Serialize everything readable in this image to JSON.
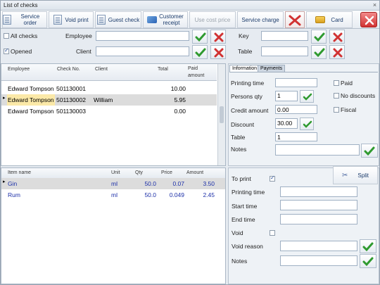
{
  "window": {
    "title": "List of checks",
    "close": "×"
  },
  "toolbar": {
    "service_order": "Service order",
    "void_print": "Void print",
    "guest_check": "Guest check",
    "customer_receipt": "Customer receipt",
    "use_cost_price": "Use cost price",
    "service_charge": "Service charge",
    "card": "Card"
  },
  "filters": {
    "all_checks": "All checks",
    "opened": "Opened",
    "employee_label": "Employee",
    "client_label": "Client",
    "key_label": "Key",
    "table_label": "Table",
    "employee_value": "",
    "client_value": "",
    "key_value": "",
    "table_value": ""
  },
  "checks_grid": {
    "headers": {
      "employee": "Employee",
      "check_no": "Check No.",
      "client": "Client",
      "total": "Total",
      "paid": "Paid amount"
    },
    "rows": [
      {
        "employee": "Edward Tompson",
        "check_no": "501130001",
        "client": "",
        "total": "10.00",
        "paid": ""
      },
      {
        "employee": "Edward Tompson",
        "check_no": "501130002",
        "client": "William",
        "total": "5.95",
        "paid": ""
      },
      {
        "employee": "Edward Tompson",
        "check_no": "501130003",
        "client": "",
        "total": "0.00",
        "paid": ""
      }
    ]
  },
  "items_grid": {
    "headers": {
      "name": "Item name",
      "unit": "Unit",
      "qty": "Qty",
      "price": "Price",
      "amount": "Amount"
    },
    "rows": [
      {
        "name": "Gin",
        "unit": "ml",
        "qty": "50.0",
        "price": "0.07",
        "amount": "3.50"
      },
      {
        "name": "Rum",
        "unit": "ml",
        "qty": "50.0",
        "price": "0.049",
        "amount": "2.45"
      }
    ]
  },
  "info": {
    "tab_information": "Information",
    "tab_payments": "Payments",
    "printing_time_label": "Printing time",
    "printing_time_value": "",
    "persons_qty_label": "Persons qty",
    "persons_qty_value": "1",
    "credit_amount_label": "Credit amount",
    "credit_amount_value": "0.00",
    "discount_label": "Discount",
    "discount_value": "30.00",
    "table_label": "Table",
    "table_value": "1",
    "notes_label": "Notes",
    "notes_value": "",
    "paid_label": "Paid",
    "no_discounts_label": "No discounts",
    "fiscal_label": "Fiscal"
  },
  "item_info": {
    "to_print_label": "To print",
    "split_label": "Split",
    "printing_time_label": "Printing time",
    "start_time_label": "Start time",
    "end_time_label": "End time",
    "void_label": "Void",
    "void_reason_label": "Void reason",
    "notes_label": "Notes",
    "printing_time_value": "",
    "start_time_value": "",
    "end_time_value": "",
    "void_reason_value": "",
    "notes_value": ""
  },
  "colors": {
    "accent_blue": "#1c2fa8",
    "selected_row": "#dcdcdc",
    "selected_cell": "#fbe9a8",
    "ok_green": "#2f9a2f",
    "cancel_red": "#d13232"
  }
}
